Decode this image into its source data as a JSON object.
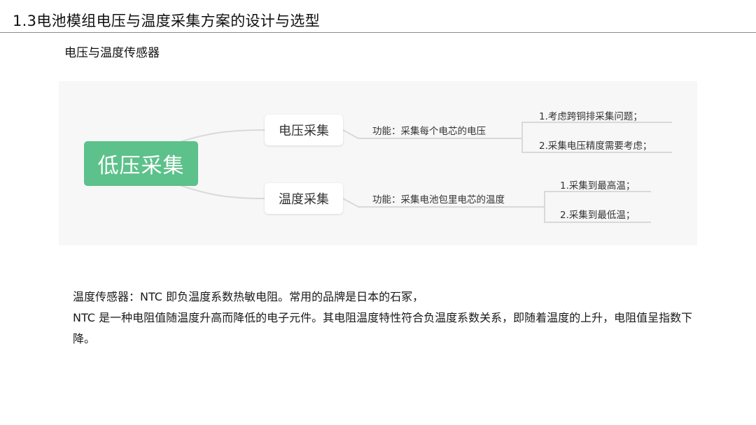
{
  "slide": {
    "title": "1.3电池模组电压与温度采集方案的设计与选型",
    "heading": "电压与温度传感器"
  },
  "mindmap": {
    "root": "低压采集",
    "branches": [
      {
        "label": "电压采集",
        "function": "功能：采集每个电芯的电压",
        "leaves": [
          "1.考虑跨铜排采集问题；",
          "2.采集电压精度需要考虑；"
        ]
      },
      {
        "label": "温度采集",
        "function": "功能：采集电池包里电芯的温度",
        "leaves": [
          "1.采集到最高温；",
          "2.采集到最低温；"
        ]
      }
    ],
    "colors": {
      "root": "#5cc18a",
      "connector": "#d9d9d9",
      "panel": "#f7f7f7"
    }
  },
  "description": {
    "lines": [
      "温度传感器：NTC 即负温度系数热敏电阻。常用的品牌是日本的石冢，",
      "NTC 是一种电阻值随温度升高而降低的电子元件。其电阻温度特性符合负温度系数关系，即随着温度的上升，电阻值呈指数下降。"
    ]
  }
}
